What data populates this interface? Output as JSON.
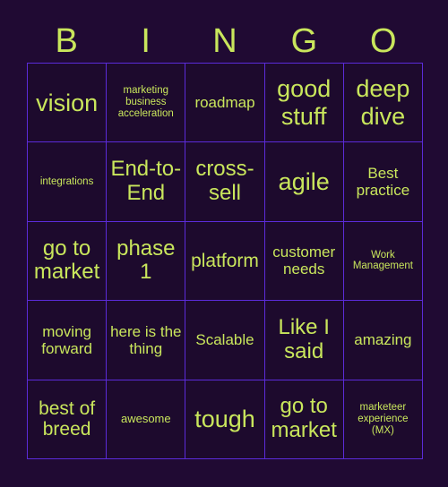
{
  "card": {
    "title": "BINGO",
    "colors": {
      "page_background": "#200a33",
      "cell_background": "#1d0a2d",
      "grid_line": "#5b2bd9",
      "text": "#c9e65c"
    },
    "header_letters": [
      "B",
      "I",
      "N",
      "G",
      "O"
    ],
    "columns": 5,
    "rows": 5,
    "cells": [
      {
        "text": "vision",
        "size": "fs-xxl"
      },
      {
        "text": "marketing business acceleration",
        "size": "fs-xs"
      },
      {
        "text": "roadmap",
        "size": "fs-md"
      },
      {
        "text": "good stuff",
        "size": "fs-xxl"
      },
      {
        "text": "deep dive",
        "size": "fs-xxl"
      },
      {
        "text": "integrations",
        "size": "fs-xs"
      },
      {
        "text": "End-to-End",
        "size": "fs-xl"
      },
      {
        "text": "cross-sell",
        "size": "fs-xl"
      },
      {
        "text": "agile",
        "size": "fs-xxl"
      },
      {
        "text": "Best practice",
        "size": "fs-md"
      },
      {
        "text": "go to market",
        "size": "fs-xl"
      },
      {
        "text": "phase 1",
        "size": "fs-xl"
      },
      {
        "text": "platform",
        "size": "fs-lg"
      },
      {
        "text": "customer needs",
        "size": "fs-md"
      },
      {
        "text": "Work Management",
        "size": "fs-xs"
      },
      {
        "text": "moving forward",
        "size": "fs-md"
      },
      {
        "text": "here is the thing",
        "size": "fs-md"
      },
      {
        "text": "Scalable",
        "size": "fs-md"
      },
      {
        "text": "Like I said",
        "size": "fs-xl"
      },
      {
        "text": "amazing",
        "size": "fs-md"
      },
      {
        "text": "best of breed",
        "size": "fs-lg"
      },
      {
        "text": "awesome",
        "size": "fs-sm"
      },
      {
        "text": "tough",
        "size": "fs-xxl"
      },
      {
        "text": "go to market",
        "size": "fs-xl"
      },
      {
        "text": "marketeer experience (MX)",
        "size": "fs-xs"
      }
    ]
  }
}
